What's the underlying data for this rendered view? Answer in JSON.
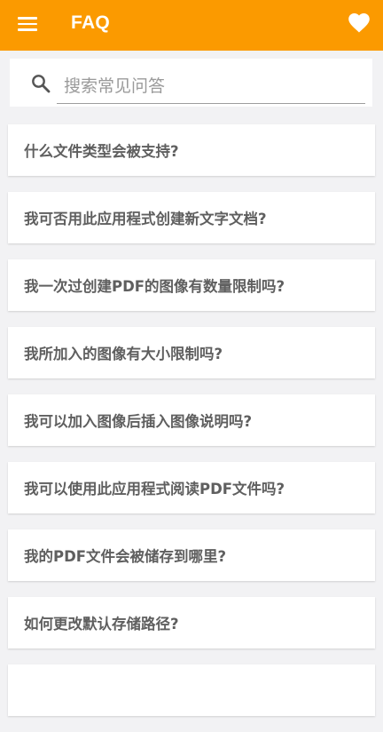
{
  "app_bar": {
    "title": "FAQ",
    "menu_icon": "hamburger-menu-icon",
    "favorite_icon": "heart-icon",
    "color": "#fb9a00"
  },
  "search": {
    "placeholder": "搜索常见问答",
    "value": ""
  },
  "faq": {
    "items": [
      {
        "question": "什么文件类型会被支持?"
      },
      {
        "question": "我可否用此应用程式创建新文字文档?"
      },
      {
        "question": "我一次过创建PDF的图像有数量限制吗?"
      },
      {
        "question": "我所加入的图像有大小限制吗?"
      },
      {
        "question": "我可以加入图像后插入图像说明吗?"
      },
      {
        "question": "我可以使用此应用程式阅读PDF文件吗?"
      },
      {
        "question": "我的PDF文件会被储存到哪里?"
      },
      {
        "question": "如何更改默认存储路径?"
      },
      {
        "question": ""
      }
    ]
  }
}
